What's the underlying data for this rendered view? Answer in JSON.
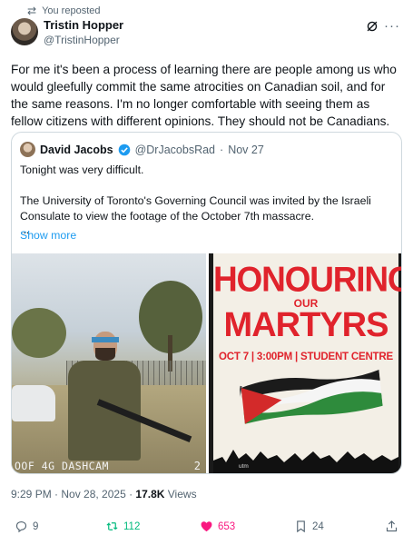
{
  "repost": {
    "label": "You reposted",
    "icon": "repost-icon"
  },
  "author": {
    "name": "Tristin Hopper",
    "handle": "@TristinHopper"
  },
  "tweet": {
    "text": "For me it's been a process of learning there are people among us who would gleefully commit the same atrocities on Canadian soil, and for the same reasons. I'm no longer comfortable with seeing them as fellow citizens with different opinions. They should not be Canadians."
  },
  "quote": {
    "name": "David Jacobs",
    "handle": "@DrJacobsRad",
    "separator": "·",
    "date": "Nov 27",
    "line1": "Tonight was very difficult.",
    "line2": "The University of Toronto's Governing Council was invited by the Israeli Consulate to view the footage of the October 7th massacre.",
    "ellipsis": "...",
    "show_more": "Show more"
  },
  "media": {
    "left_caption": "OOF 4G DASHCAM",
    "left_number": "2",
    "poster_title_1": "HONOURING",
    "poster_our": "OUR",
    "poster_title_2": "MARTYRS",
    "poster_details": "OCT 7 | 3:00PM | STUDENT CENTRE",
    "poster_footer": "utm"
  },
  "meta": {
    "time": "9:29 PM · Nov 28, 2025 · ",
    "views": "17.8K",
    "views_label": " Views"
  },
  "actions": {
    "replies": "9",
    "reposts": "112",
    "likes": "653",
    "bookmarks": "24"
  },
  "colors": {
    "accent": "#1d9bf0",
    "repost_green": "#00ba7c",
    "like_pink": "#f91880",
    "poster_red": "#e0232c"
  }
}
